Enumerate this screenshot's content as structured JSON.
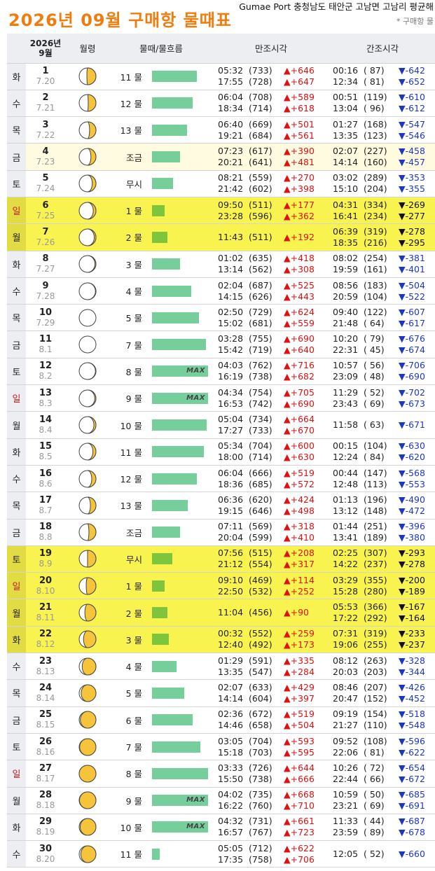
{
  "header": {
    "title": "2026년 09월 구매항 물때표",
    "port_info": "Gumae Port 충청남도 태안군 고남면 고남리 평균해",
    "note": "* 구매항 물",
    "col_date_line1": "2026년",
    "col_date_line2": "9월",
    "col_moon": "월령",
    "col_tide": "물때/물흐름",
    "col_high": "만조시각",
    "col_low": "간조시각"
  },
  "colors": {
    "title": "#f07c0d",
    "high": "#e01010",
    "low": "#1c37c4",
    "highlight_row": "#f9f34f",
    "bar": "#76cf9a",
    "bar_neap": "#7ec43c",
    "moon": "#f5c43b",
    "sunday": "#d41818"
  },
  "rows": [
    {
      "day": "1",
      "dow": "화",
      "lunar": "7.20",
      "tide_name": "11 물",
      "bar_level": 0.8,
      "max": false,
      "row": "",
      "moon": 0.54,
      "highs": [
        {
          "time": "05:32",
          "height": "(733)",
          "diff": "▲+646"
        },
        {
          "time": "17:55",
          "height": "(728)",
          "diff": "▲+647"
        }
      ],
      "lows": [
        {
          "time": "00:16",
          "height": "( 87)",
          "diff": "▼-642"
        },
        {
          "time": "12:34",
          "height": "( 81)",
          "diff": "▼-652"
        }
      ]
    },
    {
      "day": "2",
      "dow": "수",
      "lunar": "7.21",
      "tide_name": "12 물",
      "bar_level": 0.72,
      "max": false,
      "row": "",
      "moon": 0.46,
      "highs": [
        {
          "time": "06:04",
          "height": "(708)",
          "diff": "▲+589"
        },
        {
          "time": "18:34",
          "height": "(714)",
          "diff": "▲+618"
        }
      ],
      "lows": [
        {
          "time": "00:51",
          "height": "(119)",
          "diff": "▼-610"
        },
        {
          "time": "13:04",
          "height": "( 96)",
          "diff": "▼-612"
        }
      ]
    },
    {
      "day": "3",
      "dow": "목",
      "lunar": "7.22",
      "tide_name": "13 물",
      "bar_level": 0.62,
      "max": false,
      "row": "",
      "moon": 0.38,
      "highs": [
        {
          "time": "06:40",
          "height": "(669)",
          "diff": "▲+501"
        },
        {
          "time": "19:21",
          "height": "(684)",
          "diff": "▲+561"
        }
      ],
      "lows": [
        {
          "time": "01:27",
          "height": "(168)",
          "diff": "▼-547"
        },
        {
          "time": "13:35",
          "height": "(123)",
          "diff": "▼-546"
        }
      ]
    },
    {
      "day": "4",
      "dow": "금",
      "lunar": "7.23",
      "tide_name": "조금",
      "bar_level": 0.5,
      "max": false,
      "row": "jo",
      "moon": 0.3,
      "highs": [
        {
          "time": "07:23",
          "height": "(617)",
          "diff": "▲+390"
        },
        {
          "time": "20:21",
          "height": "(641)",
          "diff": "▲+481"
        }
      ],
      "lows": [
        {
          "time": "02:07",
          "height": "(227)",
          "diff": "▼-458"
        },
        {
          "time": "14:14",
          "height": "(160)",
          "diff": "▼-457"
        }
      ]
    },
    {
      "day": "5",
      "dow": "토",
      "lunar": "7.24",
      "tide_name": "무시",
      "bar_level": 0.38,
      "max": false,
      "row": "",
      "moon": 0.22,
      "highs": [
        {
          "time": "08:21",
          "height": "(559)",
          "diff": "▲+270"
        },
        {
          "time": "21:42",
          "height": "(602)",
          "diff": "▲+398"
        }
      ],
      "lows": [
        {
          "time": "03:02",
          "height": "(289)",
          "diff": "▼-353"
        },
        {
          "time": "15:10",
          "height": "(204)",
          "diff": "▼-355"
        }
      ]
    },
    {
      "day": "6",
      "dow": "일",
      "lunar": "7.25",
      "tide_name": "1 물",
      "bar_level": 0.22,
      "max": false,
      "row": "hl",
      "moon": 0.16,
      "highs": [
        {
          "time": "09:50",
          "height": "(511)",
          "diff": "▲+177"
        },
        {
          "time": "23:28",
          "height": "(596)",
          "diff": "▲+362"
        }
      ],
      "lows": [
        {
          "time": "04:31",
          "height": "(334)",
          "diff": "▼-269"
        },
        {
          "time": "16:41",
          "height": "(234)",
          "diff": "▼-277"
        }
      ]
    },
    {
      "day": "7",
      "dow": "월",
      "lunar": "7.26",
      "tide_name": "2 물",
      "bar_level": 0.28,
      "max": false,
      "row": "hl",
      "moon": 0.1,
      "highs": [
        {
          "time": "11:43",
          "height": "(511)",
          "diff": "▲+192"
        }
      ],
      "lows": [
        {
          "time": "06:39",
          "height": "(319)",
          "diff": "▼-278"
        },
        {
          "time": "18:35",
          "height": "(216)",
          "diff": "▼-295"
        }
      ]
    },
    {
      "day": "8",
      "dow": "화",
      "lunar": "7.27",
      "tide_name": "3 물",
      "bar_level": 0.5,
      "max": false,
      "row": "",
      "moon": 0.06,
      "highs": [
        {
          "time": "01:02",
          "height": "(635)",
          "diff": "▲+418"
        },
        {
          "time": "13:14",
          "height": "(562)",
          "diff": "▲+308"
        }
      ],
      "lows": [
        {
          "time": "08:02",
          "height": "(254)",
          "diff": "▼-381"
        },
        {
          "time": "19:59",
          "height": "(161)",
          "diff": "▼-401"
        }
      ]
    },
    {
      "day": "9",
      "dow": "수",
      "lunar": "7.28",
      "tide_name": "4 물",
      "bar_level": 0.7,
      "max": false,
      "row": "",
      "moon": 0.03,
      "highs": [
        {
          "time": "02:04",
          "height": "(687)",
          "diff": "▲+525"
        },
        {
          "time": "14:15",
          "height": "(626)",
          "diff": "▲+443"
        }
      ],
      "lows": [
        {
          "time": "08:56",
          "height": "(183)",
          "diff": "▼-504"
        },
        {
          "time": "20:59",
          "height": "(104)",
          "diff": "▼-522"
        }
      ]
    },
    {
      "day": "10",
      "dow": "목",
      "lunar": "7.29",
      "tide_name": "5 물",
      "bar_level": 0.84,
      "max": false,
      "row": "",
      "moon": 0.01,
      "highs": [
        {
          "time": "02:50",
          "height": "(729)",
          "diff": "▲+624"
        },
        {
          "time": "15:02",
          "height": "(681)",
          "diff": "▲+559"
        }
      ],
      "lows": [
        {
          "time": "09:40",
          "height": "(122)",
          "diff": "▼-607"
        },
        {
          "time": "21:48",
          "height": "( 64)",
          "diff": "▼-617"
        }
      ]
    },
    {
      "day": "11",
      "dow": "금",
      "lunar": "8.1",
      "tide_name": "7 물",
      "bar_level": 0.96,
      "max": false,
      "row": "",
      "moon": 0.0,
      "highs": [
        {
          "time": "03:28",
          "height": "(755)",
          "diff": "▲+690"
        },
        {
          "time": "15:42",
          "height": "(719)",
          "diff": "▲+640"
        }
      ],
      "lows": [
        {
          "time": "10:20",
          "height": "( 79)",
          "diff": "▼-676"
        },
        {
          "time": "22:31",
          "height": "( 45)",
          "diff": "▼-674"
        }
      ]
    },
    {
      "day": "12",
      "dow": "토",
      "lunar": "8.2",
      "tide_name": "8 물",
      "bar_level": 1.0,
      "max": true,
      "row": "",
      "moon": 0.03,
      "highs": [
        {
          "time": "04:03",
          "height": "(762)",
          "diff": "▲+716"
        },
        {
          "time": "16:19",
          "height": "(738)",
          "diff": "▲+682"
        }
      ],
      "lows": [
        {
          "time": "10:57",
          "height": "( 56)",
          "diff": "▼-706"
        },
        {
          "time": "23:09",
          "height": "( 48)",
          "diff": "▼-690"
        }
      ]
    },
    {
      "day": "13",
      "dow": "일",
      "lunar": "8.3",
      "tide_name": "9 물",
      "bar_level": 1.0,
      "max": true,
      "row": "",
      "moon": 0.07,
      "highs": [
        {
          "time": "04:34",
          "height": "(754)",
          "diff": "▲+705"
        },
        {
          "time": "16:53",
          "height": "(742)",
          "diff": "▲+690"
        }
      ],
      "lows": [
        {
          "time": "11:29",
          "height": "( 52)",
          "diff": "▼-702"
        },
        {
          "time": "23:43",
          "height": "( 69)",
          "diff": "▼-673"
        }
      ]
    },
    {
      "day": "14",
      "dow": "월",
      "lunar": "8.4",
      "tide_name": "10 물",
      "bar_level": 0.98,
      "max": false,
      "row": "",
      "moon": 0.12,
      "highs": [
        {
          "time": "05:04",
          "height": "(734)",
          "diff": "▲+664"
        },
        {
          "time": "17:27",
          "height": "(733)",
          "diff": "▲+670"
        }
      ],
      "lows": [
        {
          "time": "",
          "height": "",
          "diff": ""
        },
        {
          "time": "11:58",
          "height": "( 63)",
          "diff": "▼-671"
        }
      ]
    },
    {
      "day": "15",
      "dow": "화",
      "lunar": "8.5",
      "tide_name": "11 물",
      "bar_level": 0.92,
      "max": false,
      "row": "",
      "moon": 0.18,
      "highs": [
        {
          "time": "05:34",
          "height": "(704)",
          "diff": "▲+600"
        },
        {
          "time": "18:00",
          "height": "(714)",
          "diff": "▲+630"
        }
      ],
      "lows": [
        {
          "time": "00:15",
          "height": "(104)",
          "diff": "▼-630"
        },
        {
          "time": "12:24",
          "height": "( 84)",
          "diff": "▼-620"
        }
      ]
    },
    {
      "day": "16",
      "dow": "수",
      "lunar": "8.6",
      "tide_name": "12 물",
      "bar_level": 0.8,
      "max": false,
      "row": "",
      "moon": 0.25,
      "highs": [
        {
          "time": "06:04",
          "height": "(666)",
          "diff": "▲+519"
        },
        {
          "time": "18:36",
          "height": "(685)",
          "diff": "▲+572"
        }
      ],
      "lows": [
        {
          "time": "00:44",
          "height": "(147)",
          "diff": "▼-568"
        },
        {
          "time": "12:48",
          "height": "(113)",
          "diff": "▼-553"
        }
      ]
    },
    {
      "day": "17",
      "dow": "목",
      "lunar": "8.7",
      "tide_name": "13 물",
      "bar_level": 0.64,
      "max": false,
      "row": "",
      "moon": 0.33,
      "highs": [
        {
          "time": "06:36",
          "height": "(620)",
          "diff": "▲+424"
        },
        {
          "time": "19:15",
          "height": "(646)",
          "diff": "▲+498"
        }
      ],
      "lows": [
        {
          "time": "01:13",
          "height": "(196)",
          "diff": "▼-490"
        },
        {
          "time": "13:12",
          "height": "(148)",
          "diff": "▼-472"
        }
      ]
    },
    {
      "day": "18",
      "dow": "금",
      "lunar": "8.8",
      "tide_name": "조금",
      "bar_level": 0.5,
      "max": false,
      "row": "",
      "moon": 0.42,
      "highs": [
        {
          "time": "07:11",
          "height": "(569)",
          "diff": "▲+318"
        },
        {
          "time": "20:04",
          "height": "(599)",
          "diff": "▲+410"
        }
      ],
      "lows": [
        {
          "time": "01:44",
          "height": "(251)",
          "diff": "▼-396"
        },
        {
          "time": "13:41",
          "height": "(189)",
          "diff": "▼-380"
        }
      ]
    },
    {
      "day": "19",
      "dow": "토",
      "lunar": "8.9",
      "tide_name": "무시",
      "bar_level": 0.36,
      "max": false,
      "row": "hl",
      "moon": 0.5,
      "highs": [
        {
          "time": "07:56",
          "height": "(515)",
          "diff": "▲+208"
        },
        {
          "time": "21:12",
          "height": "(554)",
          "diff": "▲+317"
        }
      ],
      "lows": [
        {
          "time": "02:25",
          "height": "(307)",
          "diff": "▼-293"
        },
        {
          "time": "14:22",
          "height": "(237)",
          "diff": "▼-278"
        }
      ]
    },
    {
      "day": "20",
      "dow": "일",
      "lunar": "8.10",
      "tide_name": "1 물",
      "bar_level": 0.22,
      "max": false,
      "row": "hl",
      "moon": 0.58,
      "highs": [
        {
          "time": "09:10",
          "height": "(469)",
          "diff": "▲+114"
        },
        {
          "time": "22:50",
          "height": "(532)",
          "diff": "▲+252"
        }
      ],
      "lows": [
        {
          "time": "03:29",
          "height": "(355)",
          "diff": "▼-200"
        },
        {
          "time": "15:28",
          "height": "(280)",
          "diff": "▼-189"
        }
      ]
    },
    {
      "day": "21",
      "dow": "월",
      "lunar": "8.11",
      "tide_name": "2 물",
      "bar_level": 0.28,
      "max": false,
      "row": "hl",
      "moon": 0.66,
      "highs": [
        {
          "time": "11:04",
          "height": "(456)",
          "diff": "▲+90"
        }
      ],
      "lows": [
        {
          "time": "05:53",
          "height": "(366)",
          "diff": "▼-167"
        },
        {
          "time": "17:22",
          "height": "(292)",
          "diff": "▼-164"
        }
      ]
    },
    {
      "day": "22",
      "dow": "화",
      "lunar": "8.12",
      "tide_name": "3 물",
      "bar_level": 0.3,
      "max": false,
      "row": "hl",
      "moon": 0.74,
      "highs": [
        {
          "time": "00:32",
          "height": "(552)",
          "diff": "▲+259"
        },
        {
          "time": "12:40",
          "height": "(492)",
          "diff": "▲+173"
        }
      ],
      "lows": [
        {
          "time": "07:31",
          "height": "(319)",
          "diff": "▼-233"
        },
        {
          "time": "19:06",
          "height": "(255)",
          "diff": "▼-237"
        }
      ]
    },
    {
      "day": "23",
      "dow": "수",
      "lunar": "8.13",
      "tide_name": "4 물",
      "bar_level": 0.44,
      "max": false,
      "row": "",
      "moon": 0.82,
      "highs": [
        {
          "time": "01:29",
          "height": "(591)",
          "diff": "▲+335"
        },
        {
          "time": "13:35",
          "height": "(547)",
          "diff": "▲+284"
        }
      ],
      "lows": [
        {
          "time": "08:12",
          "height": "(263)",
          "diff": "▼-328"
        },
        {
          "time": "20:03",
          "height": "(203)",
          "diff": "▼-344"
        }
      ]
    },
    {
      "day": "24",
      "dow": "목",
      "lunar": "8.14",
      "tide_name": "5 물",
      "bar_level": 0.58,
      "max": false,
      "row": "",
      "moon": 0.88,
      "highs": [
        {
          "time": "02:07",
          "height": "(633)",
          "diff": "▲+429"
        },
        {
          "time": "14:14",
          "height": "(604)",
          "diff": "▲+397"
        }
      ],
      "lows": [
        {
          "time": "08:46",
          "height": "(207)",
          "diff": "▼-426"
        },
        {
          "time": "20:47",
          "height": "(152)",
          "diff": "▼-452"
        }
      ]
    },
    {
      "day": "25",
      "dow": "금",
      "lunar": "8.15",
      "tide_name": "6 물",
      "bar_level": 0.72,
      "max": false,
      "row": "",
      "moon": 0.93,
      "highs": [
        {
          "time": "02:36",
          "height": "(672)",
          "diff": "▲+519"
        },
        {
          "time": "14:46",
          "height": "(658)",
          "diff": "▲+504"
        }
      ],
      "lows": [
        {
          "time": "09:19",
          "height": "(154)",
          "diff": "▼-518"
        },
        {
          "time": "21:27",
          "height": "(110)",
          "diff": "▼-548"
        }
      ]
    },
    {
      "day": "26",
      "dow": "토",
      "lunar": "8.16",
      "tide_name": "7 물",
      "bar_level": 0.86,
      "max": false,
      "row": "",
      "moon": 0.97,
      "highs": [
        {
          "time": "03:05",
          "height": "(704)",
          "diff": "▲+593"
        },
        {
          "time": "15:18",
          "height": "(703)",
          "diff": "▲+595"
        }
      ],
      "lows": [
        {
          "time": "09:52",
          "height": "(108)",
          "diff": "▼-596"
        },
        {
          "time": "22:06",
          "height": "( 81)",
          "diff": "▼-622"
        }
      ]
    },
    {
      "day": "27",
      "dow": "일",
      "lunar": "8.17",
      "tide_name": "8 물",
      "bar_level": 1.0,
      "max": false,
      "row": "",
      "moon": 0.99,
      "highs": [
        {
          "time": "03:33",
          "height": "(726)",
          "diff": "▲+644"
        },
        {
          "time": "15:50",
          "height": "(738)",
          "diff": "▲+666"
        }
      ],
      "lows": [
        {
          "time": "10:26",
          "height": "( 72)",
          "diff": "▼-654"
        },
        {
          "time": "22:44",
          "height": "( 66)",
          "diff": "▼-672"
        }
      ]
    },
    {
      "day": "28",
      "dow": "월",
      "lunar": "8.18",
      "tide_name": "9 물",
      "bar_level": 1.0,
      "max": true,
      "row": "",
      "moon": 0.98,
      "highs": [
        {
          "time": "04:02",
          "height": "(735)",
          "diff": "▲+668"
        },
        {
          "time": "16:22",
          "height": "(760)",
          "diff": "▲+710"
        }
      ],
      "lows": [
        {
          "time": "10:59",
          "height": "( 50)",
          "diff": "▼-685"
        },
        {
          "time": "23:21",
          "height": "( 69)",
          "diff": "▼-691"
        }
      ]
    },
    {
      "day": "29",
      "dow": "화",
      "lunar": "8.19",
      "tide_name": "10 물",
      "bar_level": 1.0,
      "max": true,
      "row": "",
      "moon": 0.94,
      "highs": [
        {
          "time": "04:32",
          "height": "(731)",
          "diff": "▲+661"
        },
        {
          "time": "16:57",
          "height": "(767)",
          "diff": "▲+723"
        }
      ],
      "lows": [
        {
          "time": "11:33",
          "height": "( 44)",
          "diff": "▼-687"
        },
        {
          "time": "23:59",
          "height": "( 89)",
          "diff": "▼-678"
        }
      ]
    },
    {
      "day": "30",
      "dow": "수",
      "lunar": "8.20",
      "tide_name": "11 물",
      "bar_level": 0.14,
      "max": false,
      "row": "",
      "moon": 0.9,
      "highs": [
        {
          "time": "05:05",
          "height": "(712)",
          "diff": "▲+622"
        },
        {
          "time": "17:35",
          "height": "(758)",
          "diff": "▲+706"
        }
      ],
      "lows": [
        {
          "time": "",
          "height": "",
          "diff": ""
        },
        {
          "time": "12:05",
          "height": "( 52)",
          "diff": "▼-660"
        }
      ]
    }
  ],
  "max_label": "MAX"
}
